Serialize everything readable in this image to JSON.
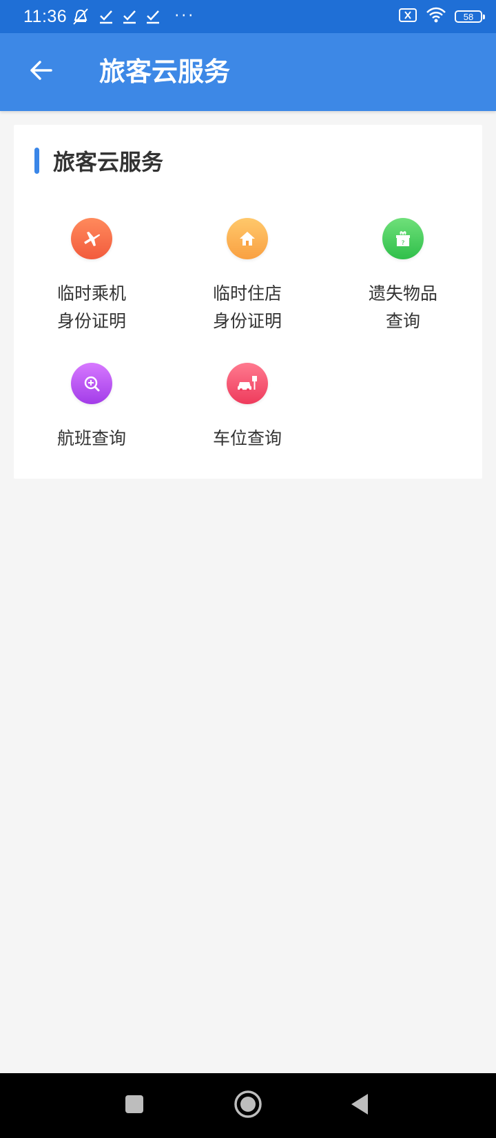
{
  "status_bar": {
    "time": "11:36",
    "more": "···",
    "battery_level": "58",
    "icons": [
      "mute-icon",
      "check-icon",
      "check-icon",
      "check-icon",
      "sim-off-icon",
      "wifi-icon",
      "battery-icon"
    ]
  },
  "app_bar": {
    "title": "旅客云服务",
    "back_icon": "arrow-left-icon"
  },
  "section": {
    "title": "旅客云服务",
    "accent_color": "#3a86e8"
  },
  "services": [
    {
      "id": "flight-id",
      "lines": [
        "临时乘机",
        "身份证明"
      ],
      "icon": "airplane-icon",
      "color_top": "#ff8a5c",
      "color_bottom": "#f25b3d"
    },
    {
      "id": "hotel-id",
      "lines": [
        "临时住店",
        "身份证明"
      ],
      "icon": "house-icon",
      "color_top": "#ffc86b",
      "color_bottom": "#f9a042"
    },
    {
      "id": "lost-items",
      "lines": [
        "遗失物品",
        "查询"
      ],
      "icon": "lost-box-icon",
      "color_top": "#6fe07a",
      "color_bottom": "#2fbf4a"
    },
    {
      "id": "flight-query",
      "lines": [
        "航班查询"
      ],
      "icon": "search-plus-icon",
      "color_top": "#d779ff",
      "color_bottom": "#a23ce8"
    },
    {
      "id": "parking-query",
      "lines": [
        "车位查询"
      ],
      "icon": "car-parking-icon",
      "color_top": "#ff7a8f",
      "color_bottom": "#ee3b5c"
    }
  ],
  "nav_bar": {
    "buttons": [
      "recents-icon",
      "home-icon",
      "back-triangle-icon"
    ]
  }
}
